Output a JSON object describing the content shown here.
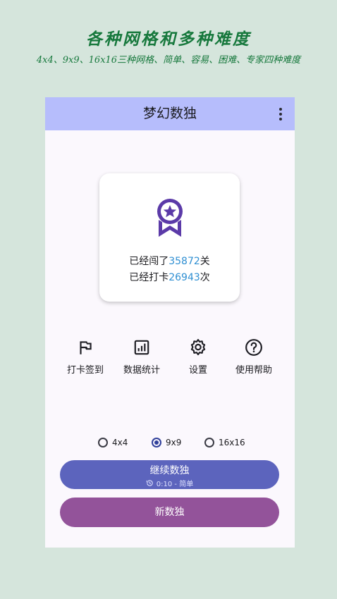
{
  "promo": {
    "title": "各种网格和多种难度",
    "subtitle": "4x4、9x9、16x16三种网格、简单、容易、困难、专家四种难度"
  },
  "app": {
    "title": "梦幻数独",
    "menu_icon": "more-vert-icon"
  },
  "summary_card": {
    "icon": "award-badge-icon",
    "passed_prefix": "已经闯了",
    "passed_count": "35872",
    "passed_suffix": "关",
    "checkin_prefix": "已经打卡",
    "checkin_count": "26943",
    "checkin_suffix": "次"
  },
  "actions": [
    {
      "icon": "flag-icon",
      "label": "打卡签到"
    },
    {
      "icon": "bar-chart-icon",
      "label": "数据统计"
    },
    {
      "icon": "gear-icon",
      "label": "设置"
    },
    {
      "icon": "help-circle-icon",
      "label": "使用帮助"
    }
  ],
  "grid_options": {
    "options": [
      "4x4",
      "9x9",
      "16x16"
    ],
    "selected": "9x9"
  },
  "continue_button": {
    "label": "继续数独",
    "detail": "0:10 - 简单",
    "detail_icon": "history-icon"
  },
  "new_button": {
    "label": "新数独"
  },
  "colors": {
    "app_bar": "#b6bdfc",
    "continue": "#5c64bd",
    "new": "#93539a",
    "badge": "#5b3aa8",
    "accent_number": "#2f8fd2",
    "promo_text": "#16783c"
  }
}
